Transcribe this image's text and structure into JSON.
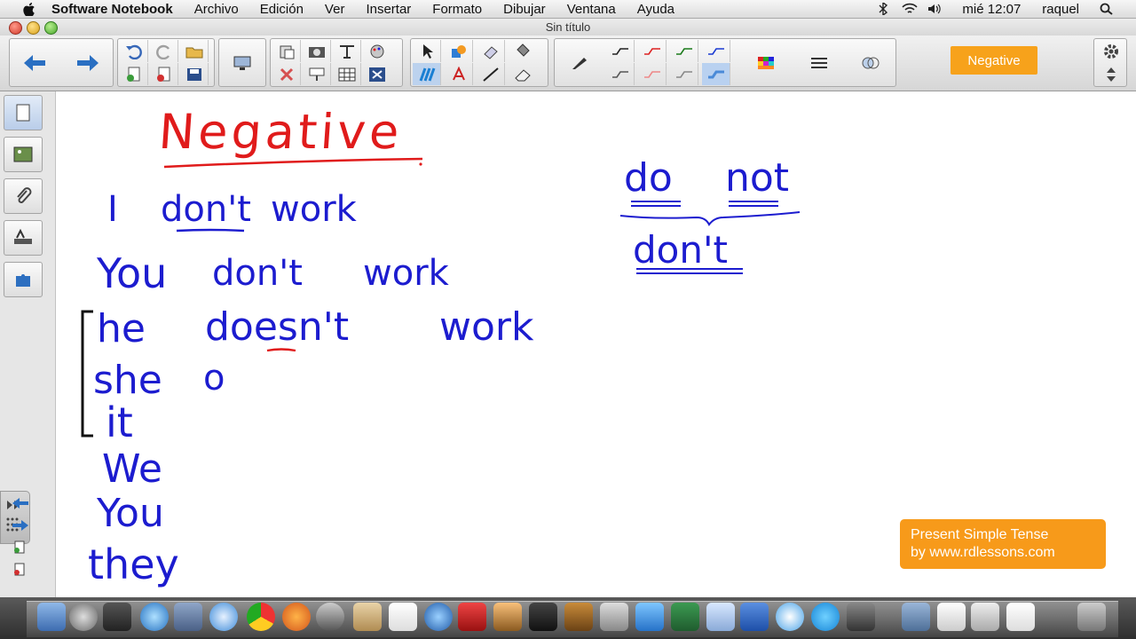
{
  "menubar": {
    "app_name": "Software Notebook",
    "items": [
      "Archivo",
      "Edición",
      "Ver",
      "Insertar",
      "Formato",
      "Dibujar",
      "Ventana",
      "Ayuda"
    ],
    "clock": "mié 12:07",
    "user": "raquel"
  },
  "window": {
    "title": "Sin título"
  },
  "toolbar": {
    "page_title_badge": "Negative"
  },
  "canvas": {
    "title": "Negative",
    "lines": [
      {
        "pronoun": "I",
        "verb": "don't",
        "rest": "work"
      },
      {
        "pronoun": "You",
        "verb": "don't",
        "rest": "work"
      },
      {
        "pronoun": "he",
        "verb": "doesn't",
        "rest": "work"
      },
      {
        "pronoun": "she",
        "verb": "o",
        "rest": ""
      },
      {
        "pronoun": "it",
        "verb": "",
        "rest": ""
      },
      {
        "pronoun": "We",
        "verb": "",
        "rest": ""
      },
      {
        "pronoun": "You",
        "verb": "",
        "rest": ""
      },
      {
        "pronoun": "they",
        "verb": "",
        "rest": ""
      }
    ],
    "contraction": {
      "word1": "do",
      "word2": "not",
      "result": "don't"
    },
    "promo_line1": "Present Simple Tense",
    "promo_line2": "by www.rdlessons.com"
  },
  "colors": {
    "ink_blue": "#1c1ccf",
    "ink_red": "#e01b1b",
    "badge_orange": "#f7a21b"
  }
}
